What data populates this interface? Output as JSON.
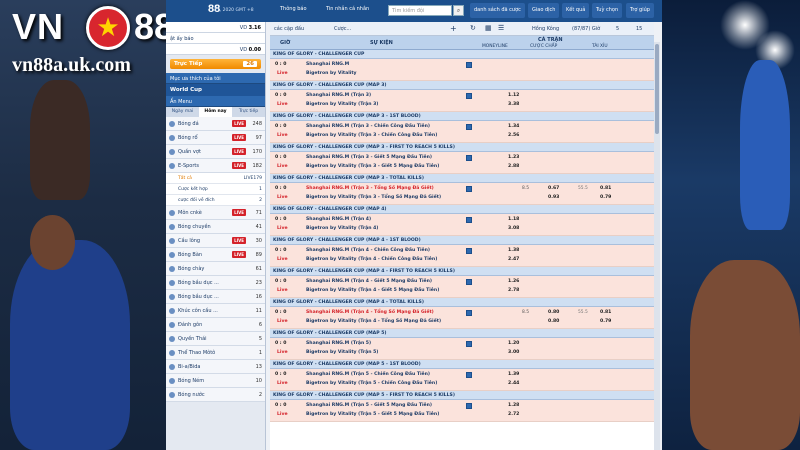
{
  "logo": {
    "brand_left": "VN",
    "brand_right": "88",
    "star": "★",
    "url": "vn88a.uk.com"
  },
  "topbar": {
    "brand": "88",
    "datetime": "27, 2020 GMT +8",
    "notice": "Thông báo",
    "inbox": "Tin nhắn cá nhân",
    "search_placeholder": "Tìm kiếm đội",
    "search_icon": "magnifier-icon",
    "nav": [
      "danh sách đã cược",
      "Giao dịch",
      "Kết quả",
      "Tuỳ chọn",
      "Trợ giúp"
    ]
  },
  "left": {
    "balance_label": "VD",
    "balance": "3.16",
    "account_label": "ật ấy báo",
    "credit_label": "VD",
    "credit": "0.00",
    "deposit_label": "Trực Tiếp",
    "deposit_value": "26",
    "favorites": "Mục ưa thích của tôi",
    "worldcup": "World Cup",
    "menu": "Ẩn Menu",
    "tabs": [
      "Ngày mai",
      "Hôm nay",
      "Trực tiếp"
    ],
    "sports": [
      {
        "name": "Bóng đá",
        "live": true,
        "count": "248"
      },
      {
        "name": "Bóng rổ",
        "live": true,
        "count": "97"
      },
      {
        "name": "Quần vợt",
        "live": true,
        "count": "170"
      },
      {
        "name": "E-Sports",
        "live": true,
        "count": "182"
      }
    ],
    "subs": [
      {
        "name": "Tất cả",
        "live": true,
        "count": "179",
        "on": true
      },
      {
        "name": "Cược kết hợp",
        "live": false,
        "count": "1",
        "on": false
      },
      {
        "name": "cược đối về đích",
        "live": false,
        "count": "2",
        "on": false
      }
    ],
    "sports2": [
      {
        "name": "Môn cnkè",
        "live": true,
        "count": "71"
      },
      {
        "name": "Bóng chuyền",
        "live": false,
        "count": "41"
      },
      {
        "name": "Cầu lông",
        "live": true,
        "count": "30"
      },
      {
        "name": "Bóng Bàn",
        "live": true,
        "count": "89"
      },
      {
        "name": "Bóng chày",
        "live": false,
        "count": "61"
      },
      {
        "name": "Bóng bầu dục ...",
        "live": false,
        "count": "23"
      },
      {
        "name": "Bóng bầu dục ...",
        "live": false,
        "count": "16"
      },
      {
        "name": "Khúc côn cầu ...",
        "live": false,
        "count": "11"
      },
      {
        "name": "Đánh gôn",
        "live": false,
        "count": "6"
      },
      {
        "name": "Quyền Thái",
        "live": false,
        "count": "5"
      },
      {
        "name": "Thể Thao Môtô",
        "live": false,
        "count": "1"
      },
      {
        "name": "Bi-a/Bida",
        "live": false,
        "count": "13"
      },
      {
        "name": "Bóng Ném",
        "live": false,
        "count": "10"
      },
      {
        "name": "Bóng nước",
        "live": false,
        "count": "2"
      }
    ]
  },
  "main": {
    "filter_label": "các cặp đấu",
    "filter_sub": "Cược...",
    "market": "Hồng Kông",
    "count": "(87/87) Giờ",
    "badge1": "5",
    "badge2": "15",
    "col_time": "GIỜ",
    "col_event": "SỰ KIỆN",
    "col_group": "CÁ TRẬN",
    "col_ml": "MONEYLINE",
    "col_hc": "CƯỢC CHẤP",
    "col_ou": "TÀI XỈU",
    "live_label": "Live",
    "blocks": [
      {
        "league": "KING OF GLORY - CHALLENGER CUP",
        "score": "0 : 0",
        "home": "Shanghai RNG.M",
        "away": "Bigetron by Vitality",
        "o1": "",
        "o2": "",
        "red": false
      },
      {
        "league": "KING OF GLORY - CHALLENGER CUP (MAP 3)",
        "score": "0 : 0",
        "home": "Shanghai RNG.M (Trận 3)",
        "away": "Bigetron by Vitality (Trận 3)",
        "o1": "1.12",
        "o2": "3.38",
        "red": false
      },
      {
        "league": "KING OF GLORY - CHALLENGER CUP (MAP 3 - 1ST BLOOD)",
        "score": "0 : 0",
        "home": "Shanghai RNG.M (Trận 3 - Chiến Công Đầu Tiên)",
        "away": "Bigetron by Vitality (Trận 3 - Chiến Công Đầu Tiên)",
        "o1": "1.34",
        "o2": "2.56",
        "red": false
      },
      {
        "league": "KING OF GLORY - CHALLENGER CUP (MAP 3 - FIRST TO REACH 5 KILLS)",
        "score": "0 : 0",
        "home": "Shanghai RNG.M (Trận 3 - Giết 5 Mạng Đầu Tiên)",
        "away": "Bigetron by Vitality (Trận 3 - Giết 5 Mạng Đầu Tiên)",
        "o1": "1.23",
        "o2": "2.88",
        "red": false
      },
      {
        "league": "KING OF GLORY - CHALLENGER CUP (MAP 3 - TOTAL KILLS)",
        "score": "0 : 0",
        "home": "Shanghai RNG.M (Trận 3 - Tổng Số Mạng Đã Giết)",
        "away": "Bigetron by Vitality (Trận 3 - Tổng Số Mạng Đã Giết)",
        "o1": "",
        "o2": "",
        "red": true,
        "hc": "8.5",
        "p1": "0.67",
        "p2": "0.93",
        "hc2": "55.5",
        "q1": "0.81",
        "q2": "0.79"
      },
      {
        "league": "KING OF GLORY - CHALLENGER CUP (MAP 4)",
        "score": "0 : 0",
        "home": "Shanghai RNG.M (Trận 4)",
        "away": "Bigetron by Vitality (Trận 4)",
        "o1": "1.18",
        "o2": "3.08",
        "red": false
      },
      {
        "league": "KING OF GLORY - CHALLENGER CUP (MAP 4 - 1ST BLOOD)",
        "score": "0 : 0",
        "home": "Shanghai RNG.M (Trận 4 - Chiến Công Đầu Tiên)",
        "away": "Bigetron by Vitality (Trận 4 - Chiến Công Đầu Tiên)",
        "o1": "1.38",
        "o2": "2.47",
        "red": false
      },
      {
        "league": "KING OF GLORY - CHALLENGER CUP (MAP 4 - FIRST TO REACH 5 KILLS)",
        "score": "0 : 0",
        "home": "Shanghai RNG.M (Trận 4 - Giết 5 Mạng Đầu Tiên)",
        "away": "Bigetron by Vitality (Trận 4 - Giết 5 Mạng Đầu Tiên)",
        "o1": "1.26",
        "o2": "2.78",
        "red": false
      },
      {
        "league": "KING OF GLORY - CHALLENGER CUP (MAP 4 - TOTAL KILLS)",
        "score": "0 : 0",
        "home": "Shanghai RNG.M (Trận 4 - Tổng Số Mạng Đã Giết)",
        "away": "Bigetron by Vitality (Trận 4 - Tổng Số Mạng Đã Giết)",
        "o1": "",
        "o2": "",
        "red": true,
        "hc": "8.5",
        "p1": "0.80",
        "p2": "0.80",
        "hc2": "55.5",
        "q1": "0.81",
        "q2": "0.79"
      },
      {
        "league": "KING OF GLORY - CHALLENGER CUP (MAP 5)",
        "score": "0 : 0",
        "home": "Shanghai RNG.M (Trận 5)",
        "away": "Bigetron by Vitality (Trận 5)",
        "o1": "1.20",
        "o2": "3.00",
        "red": false
      },
      {
        "league": "KING OF GLORY - CHALLENGER CUP (MAP 5 - 1ST BLOOD)",
        "score": "0 : 0",
        "home": "Shanghai RNG.M (Trận 5 - Chiến Công Đầu Tiên)",
        "away": "Bigetron by Vitality (Trận 5 - Chiến Công Đầu Tiên)",
        "o1": "1.39",
        "o2": "2.44",
        "red": false
      },
      {
        "league": "KING OF GLORY - CHALLENGER CUP (MAP 5 - FIRST TO REACH 5 KILLS)",
        "score": "0 : 0",
        "home": "Shanghai RNG.M (Trận 5 - Giết 5 Mạng Đầu Tiên)",
        "away": "Bigetron by Vitality (Trận 5 - Giết 5 Mạng Đầu Tiên)",
        "o1": "1.28",
        "o2": "2.72",
        "red": false
      }
    ]
  }
}
